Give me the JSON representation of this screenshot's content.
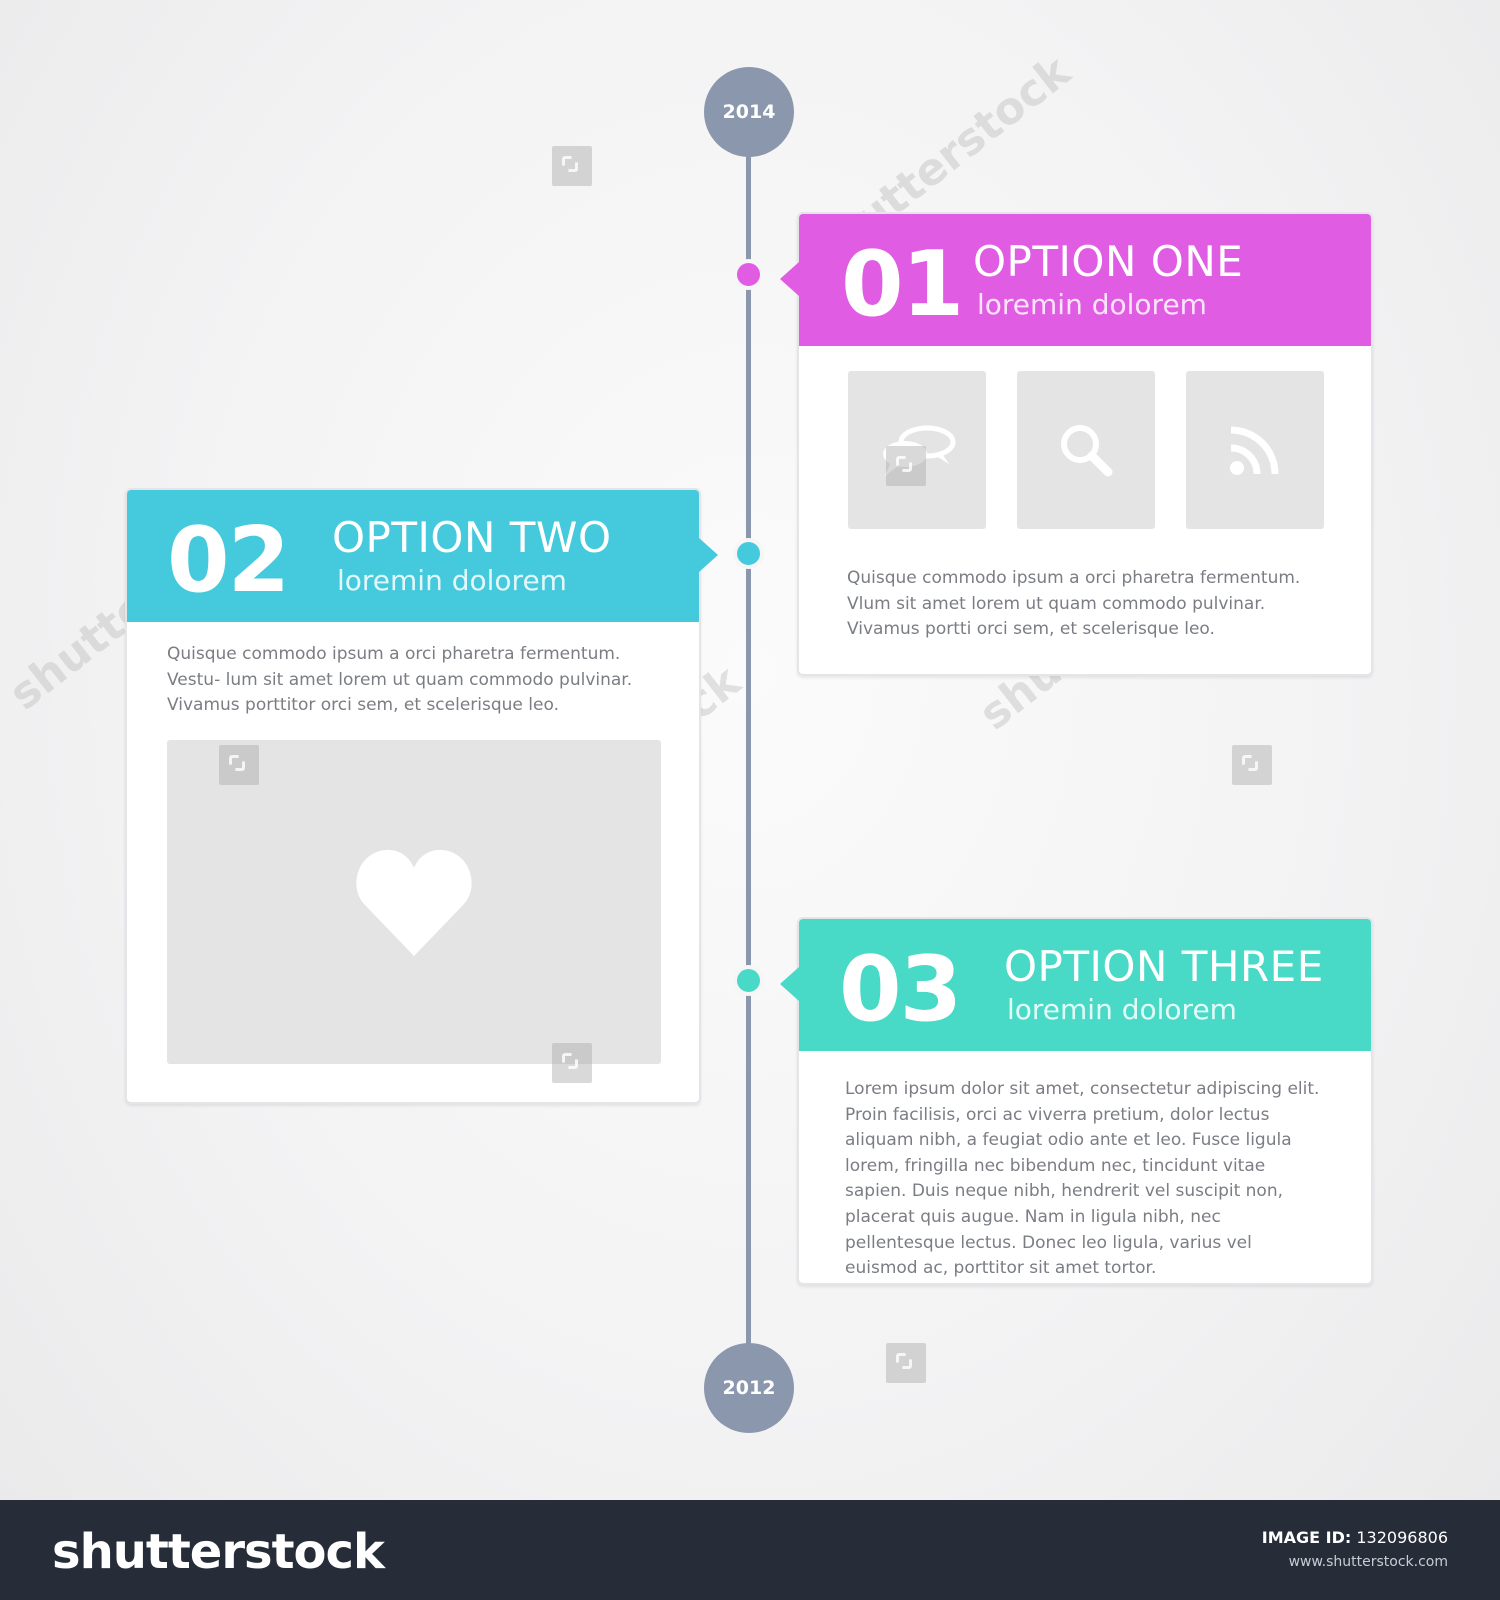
{
  "timeline": {
    "year_top": "2014",
    "year_bottom": "2012",
    "line_color": "#8b97ad"
  },
  "cards": [
    {
      "number": "01",
      "title": "OPTION ONE",
      "subtitle": "loremin dolorem",
      "color": "#e05ce2",
      "text": "Quisque commodo ipsum a orci pharetra fermentum. Vlum sit amet lorem ut quam commodo pulvinar. Vivamus portti orci sem, et scelerisque leo.",
      "icons": [
        "chat-bubbles-icon",
        "search-icon",
        "rss-icon"
      ]
    },
    {
      "number": "02",
      "title": "OPTION TWO",
      "subtitle": "loremin dolorem",
      "color": "#45c9dc",
      "text": "Quisque commodo ipsum a orci pharetra fermentum. Vestu- lum sit amet lorem ut quam commodo pulvinar. Vivamus porttitor orci sem, et scelerisque leo.",
      "icons": [
        "heart-icon"
      ]
    },
    {
      "number": "03",
      "title": "OPTION THREE",
      "subtitle": "loremin dolorem",
      "color": "#48dac6",
      "text": "Lorem ipsum dolor sit amet, consectetur adipiscing elit. Proin facilisis, orci ac viverra pretium, dolor lectus aliquam nibh, a feugiat odio ante et leo. Fusce ligula lorem, fringilla nec bibendum nec, tincidunt vitae sapien. Duis neque nibh, hendrerit vel suscipit non, placerat quis augue. Nam in ligula nibh, nec pellentesque lectus. Donec leo ligula, varius vel euismod ac, porttitor sit amet tortor."
    }
  ],
  "footer": {
    "logo": "shutterstock",
    "image_id_label": "IMAGE ID:",
    "image_id": "132096806",
    "url": "www.shutterstock.com"
  }
}
